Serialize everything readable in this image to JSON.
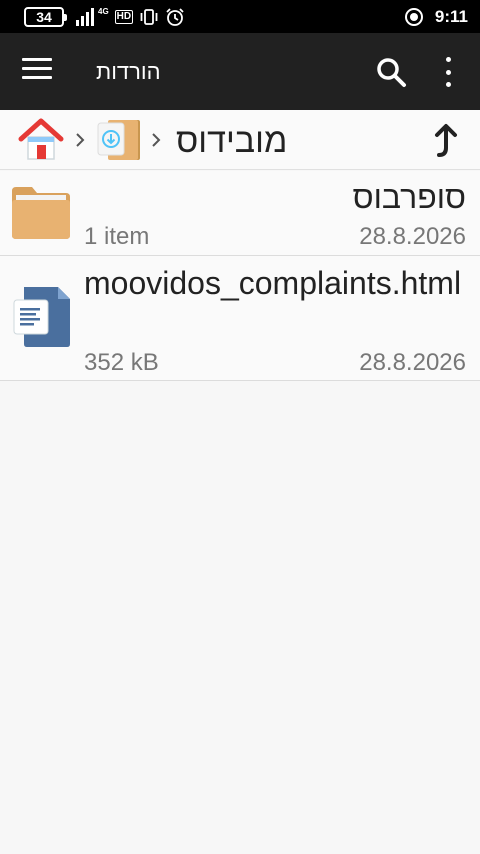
{
  "status_bar": {
    "battery_level": "34",
    "network_type": "4G",
    "hd_label": "HD",
    "time": "9:11"
  },
  "toolbar": {
    "title": "הורדות",
    "menu_icon": "hamburger-menu-icon",
    "search_icon": "search-icon",
    "more_icon": "more-vertical-icon"
  },
  "breadcrumb": {
    "home_icon": "home-icon",
    "folder_icon": "download-folder-icon",
    "current": "מובידוס",
    "up_icon": "navigate-up-icon"
  },
  "files": [
    {
      "name": "סופרבוס",
      "type": "folder",
      "info": "1 item",
      "date": "28.8.2026"
    },
    {
      "name": "moovidos_complaints.html",
      "type": "html-document",
      "info": "352 kB",
      "date": "28.8.2026"
    }
  ],
  "colors": {
    "toolbar_bg": "#212121",
    "status_bg": "#000000",
    "list_bg": "#fafafa",
    "folder_color": "#e8b271",
    "document_color": "#4a6f9e",
    "home_roof": "#e53935"
  }
}
